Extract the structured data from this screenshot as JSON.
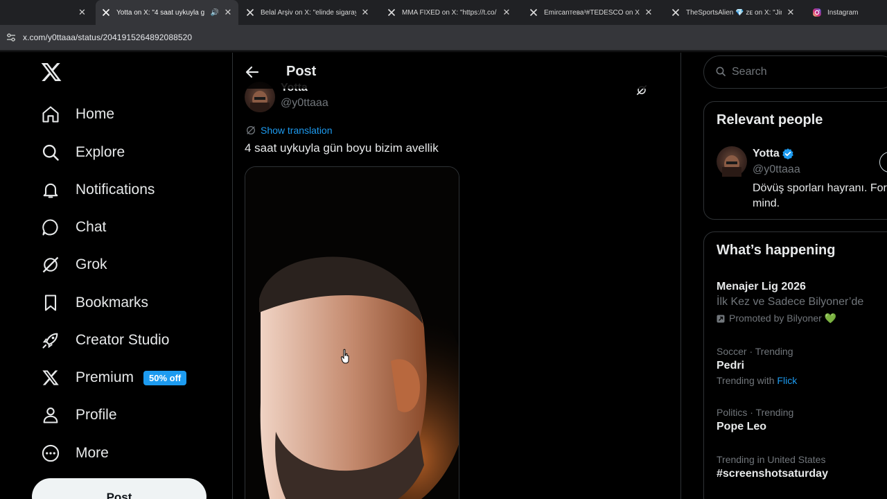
{
  "browser": {
    "tabs": [
      {
        "title": "Yotta on X: \"4 saat uykuyla g",
        "icon": "x-logo-icon",
        "active": true,
        "audio": true
      },
      {
        "title": "Belal Arşiv on X: \"elinde sigaray",
        "icon": "x-logo-icon",
        "active": false
      },
      {
        "title": "MMA FIXED on X: \"https://t.co/",
        "icon": "x-logo-icon",
        "active": false
      },
      {
        "title": "Emircanтеваᵌ#TEDESCO on X: \"I",
        "icon": "x-logo-icon",
        "active": false
      },
      {
        "title": "TheSportsAlien 💎 ᴢᴇ on X: \"Jiri",
        "icon": "x-logo-icon",
        "active": false
      },
      {
        "title": "Instagram",
        "icon": "instagram-icon",
        "active": false
      }
    ],
    "url": "x.com/y0ttaaa/status/2041915264892088520"
  },
  "nav": {
    "items": [
      {
        "label": "Home",
        "icon": "home-icon"
      },
      {
        "label": "Explore",
        "icon": "search-icon"
      },
      {
        "label": "Notifications",
        "icon": "bell-icon"
      },
      {
        "label": "Chat",
        "icon": "chat-bubble-icon"
      },
      {
        "label": "Grok",
        "icon": "grok-icon"
      },
      {
        "label": "Bookmarks",
        "icon": "bookmark-icon"
      },
      {
        "label": "Creator Studio",
        "icon": "rocket-icon"
      },
      {
        "label": "Premium",
        "icon": "x-logo-icon",
        "badge": "50% off"
      },
      {
        "label": "Profile",
        "icon": "person-icon"
      },
      {
        "label": "More",
        "icon": "more-circle-icon"
      }
    ],
    "post_button": "Post"
  },
  "main": {
    "header_title": "Post",
    "author": {
      "name": "Yotta",
      "handle": "@y0ttaaa"
    },
    "show_translation": "Show translation",
    "text": "4 saat uykuyla gün boyu bizim avellik"
  },
  "sidebar": {
    "search_placeholder": "Search",
    "relevant_people": {
      "title": "Relevant people",
      "name": "Yotta",
      "handle": "@y0ttaaa",
      "bio_line1": "Dövüş sporları hayranı. For",
      "bio_line2": "mind."
    },
    "happening": {
      "title": "What’s happening",
      "trends": [
        {
          "meta": "",
          "name": "Menajer Lig 2026",
          "sub": "İlk Kez ve Sadece Bilyoner’de",
          "promo": "Promoted by Bilyoner 💚"
        },
        {
          "meta": "Soccer · Trending",
          "name": "Pedri",
          "sub_prefix": "Trending with",
          "sub_link": "Flick"
        },
        {
          "meta": "Politics · Trending",
          "name": "Pope Leo"
        },
        {
          "meta": "Trending in United States",
          "name": "#screenshotsaturday"
        }
      ]
    }
  },
  "colors": {
    "accent": "#1d9bf0",
    "background": "#000000",
    "border": "#2f3336",
    "muted": "#71767b",
    "text": "#e7e9ea"
  }
}
